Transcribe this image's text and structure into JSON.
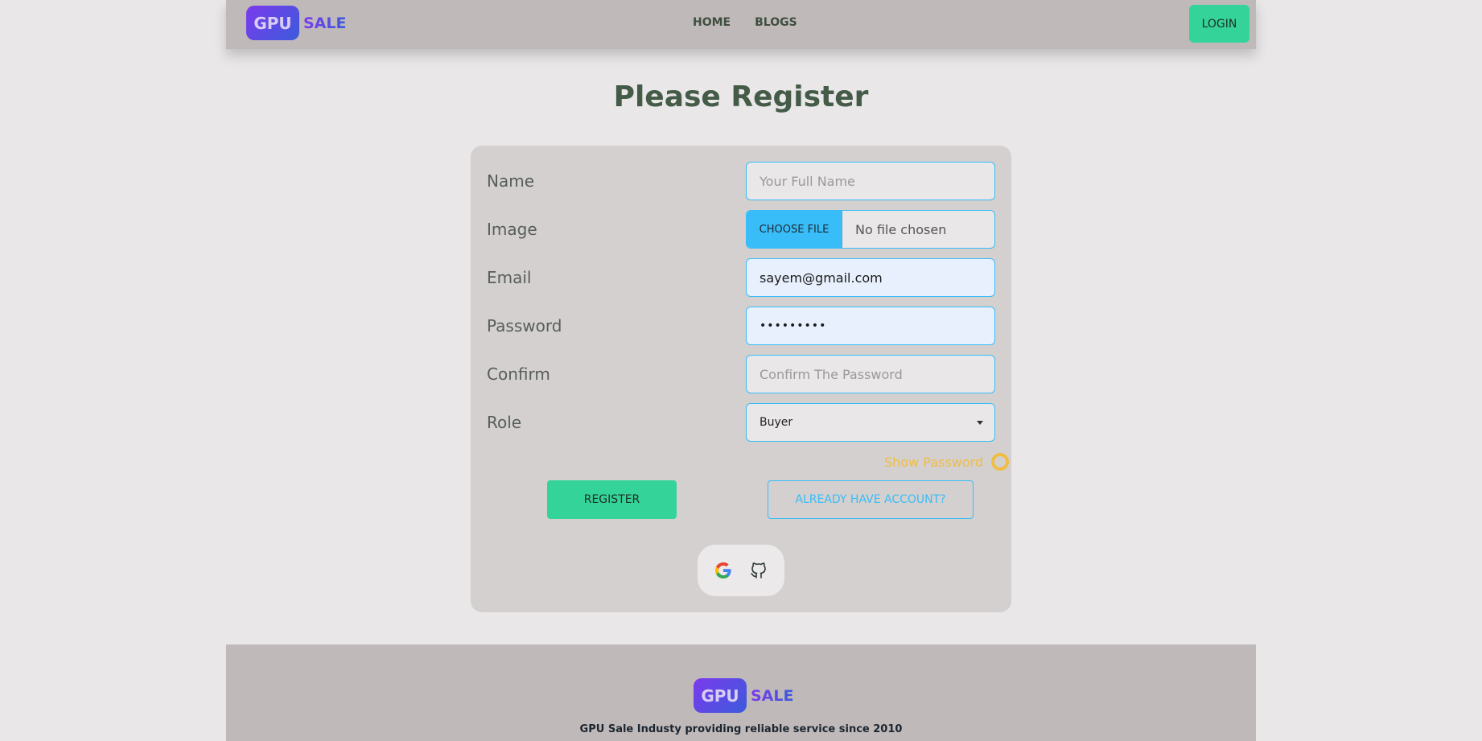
{
  "nav": {
    "logo_badge": "GPU",
    "logo_text": "SALE",
    "links": [
      "HOME",
      "BLOGS"
    ],
    "login_label": "LOGIN"
  },
  "title": "Please Register",
  "form": {
    "name": {
      "label": "Name",
      "placeholder": "Your Full Name"
    },
    "image": {
      "label": "Image",
      "button": "CHOOSE FILE",
      "status": "No file chosen"
    },
    "email": {
      "label": "Email",
      "value": "sayem@gmail.com"
    },
    "password": {
      "label": "Password",
      "value": "•••••••••"
    },
    "confirm": {
      "label": "Confirm",
      "placeholder": "Confirm The Password"
    },
    "role": {
      "label": "Role",
      "value": "Buyer"
    },
    "show_password": "Show Password",
    "register_label": "REGISTER",
    "account_label": "ALREADY HAVE ACCOUNT?"
  },
  "social": {
    "icons": [
      "google-icon",
      "github-icon"
    ]
  },
  "footer": {
    "logo_badge": "GPU",
    "logo_text": "SALE",
    "tagline": "GPU Sale Industy providing reliable service since 2010"
  },
  "colors": {
    "accent_green": "#34d399",
    "accent_blue": "#38bdf8",
    "accent_yellow": "#f0bd42",
    "navbar_bg": "#c0b9ba",
    "title_color": "#435b47"
  }
}
